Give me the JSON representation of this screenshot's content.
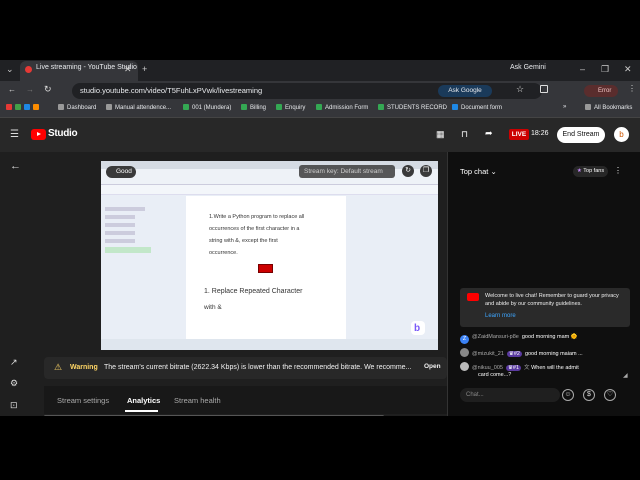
{
  "browser": {
    "tab_title": "Live streaming - YouTube Studio",
    "url": "studio.youtube.com/video/T5FuhLxPVwk/livestreaming",
    "ask_google": "Ask Google",
    "ask_gemini": "Ask Gemini",
    "profile_label": "Error",
    "bookmarks": [
      "Dashboard",
      "Manual attendence...",
      "001 (Mundera)",
      "Billing",
      "Enquiry",
      "Admission Form",
      "STUDENTS RECORD",
      "Document form"
    ],
    "all_bookmarks": "All Bookmarks"
  },
  "studio": {
    "logo_text": "Studio",
    "live_badge": "LIVE",
    "live_time": "18:26",
    "end_stream": "End Stream",
    "avatar_letter": "b"
  },
  "preview": {
    "status": "Good",
    "stream_key": "Stream key: Default stream",
    "doc_lines": [
      "1.Write a Python program to replace all",
      "occurrences of the first character in a",
      "string with &, except the first",
      "occurrence."
    ],
    "doc_heading": "1. Replace Repeated Character",
    "doc_sub": "with &"
  },
  "warning": {
    "label": "Warning",
    "message": "The stream's current bitrate (2622.34 Kbps) is lower than the recommended bitrate. We recomme...",
    "open": "Open"
  },
  "tabs": [
    "Stream settings",
    "Analytics",
    "Stream health"
  ],
  "active_tab": "Analytics",
  "chat": {
    "header": "Top chat",
    "top_fans": "Top fans",
    "welcome": "Welcome to live chat! Remember to guard your privacy and abide by our community guidelines.",
    "learn_more": "Learn more",
    "messages": [
      {
        "user": "@ZaidMansuri-p8e",
        "badge": "",
        "text": "good morning mam 🌞",
        "avatar": "Z",
        "color": "#3b82f6"
      },
      {
        "user": "@mizukit_21",
        "badge": "#2",
        "text": "good morning maiam ...",
        "avatar": "",
        "color": "#888888"
      },
      {
        "user": "@nikuu_005",
        "badge": "#1",
        "text": "When will the admit",
        "avatar": "",
        "color": "#bbbbbb"
      },
      {
        "user": "",
        "badge": "",
        "text": "card come...?",
        "avatar": "",
        "color": ""
      }
    ],
    "input_placeholder": "Chat..."
  }
}
